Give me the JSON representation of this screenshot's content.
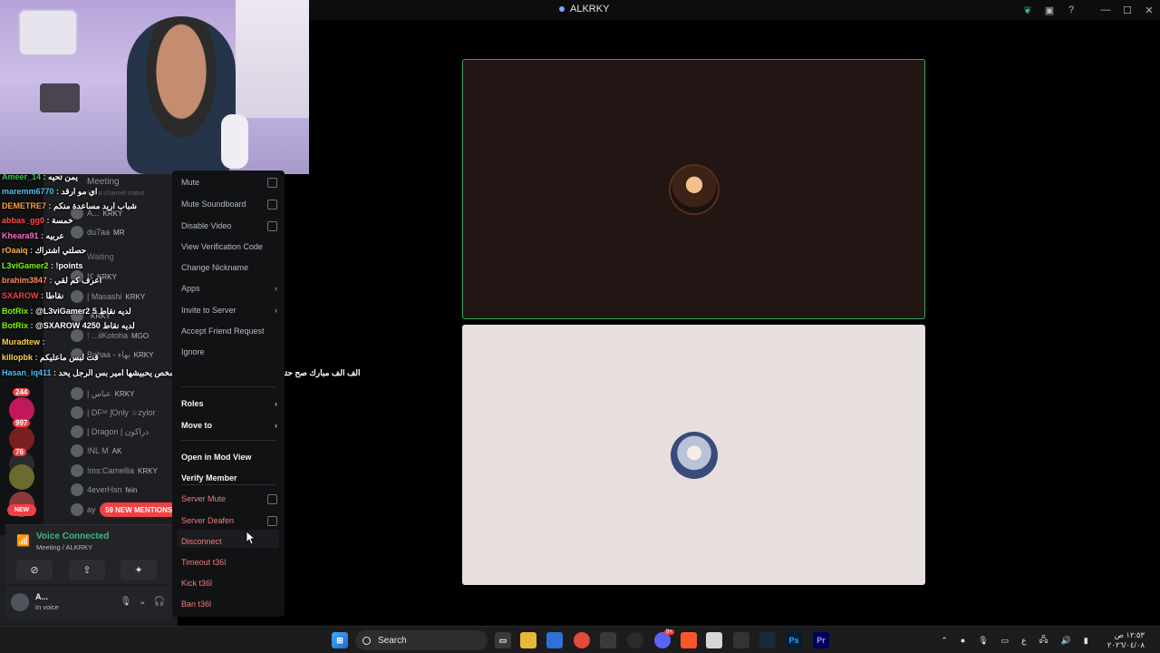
{
  "window": {
    "title": "ALKRKY"
  },
  "chat": [
    {
      "user": "Ameer_14",
      "msg": "يمن تحيه",
      "color": "#36c75b"
    },
    {
      "user": "maremm6770",
      "msg": "اي مو ارقد",
      "color": "#4fc3f7"
    },
    {
      "user": "DEMETRE7",
      "msg": "شباب اريد مساعدة منكم",
      "color": "#ff9e3d"
    },
    {
      "user": "abbas_gg0",
      "msg": "خمسة",
      "color": "#ff4f4f"
    },
    {
      "user": "Kheara91",
      "msg": "عربيه",
      "color": "#ff6bd0"
    },
    {
      "user": "rOaaiq",
      "msg": "حصلتي اشتراك",
      "color": "#ffb347"
    },
    {
      "user": "L3viGamer2",
      "msg": "!points",
      "color": "#7cfc00"
    },
    {
      "user": "brahim3847",
      "msg": "اعرف كم لقي",
      "color": "#ff8a65"
    },
    {
      "user": "SXAROW",
      "msg": "نقاطا",
      "color": "#ff4040"
    },
    {
      "user": "BotRix",
      "msg": "@L3viGamer2 لديه نقاط 5",
      "color": "#7cfc00"
    },
    {
      "user": "BotRix",
      "msg": "@SXAROW لديه نقاط 4250",
      "color": "#7cfc00"
    },
    {
      "user": "Muradtew",
      "msg": "",
      "color": "#ffd54f"
    },
    {
      "user": "killopbk",
      "msg": "قت لبس ماعليكم",
      "color": "#ffd54f"
    },
    {
      "user": "Hasan_iq411",
      "msg": "الف الف مبارك صح حته البنيه بس البتيه ممكن تتزوج كبشخص يحبيشها امير بس الرجل يحد",
      "color": "#4fc3f7"
    }
  ],
  "sidebar": {
    "channel": "Meeting",
    "channel_status": "Set a channel status",
    "members": [
      {
        "name": "A...",
        "tag": "KRKY"
      },
      {
        "name": "du7aa",
        "tag": "MR"
      },
      {
        "name": "Waiting",
        "tag": ""
      },
      {
        "name": "ﻛﺎ",
        "tag": "KRKY"
      },
      {
        "name": "| Masashi",
        "tag": "KRKY"
      },
      {
        "name": "",
        "tag": "KRKY"
      },
      {
        "name": "⁞ ...iiKotoha",
        "tag": "MGO"
      },
      {
        "name": "Bahaa - بهاء",
        "tag": "KRKY"
      },
      {
        "name": "| عباس",
        "tag": "KRKY"
      },
      {
        "name": "| DFˢˣ ʃOnly ☆zylor",
        "tag": ""
      },
      {
        "name": "| Dragon | دراكون",
        "tag": ""
      },
      {
        "name": "!NL M",
        "tag": "AK"
      },
      {
        "name": "!ms:Camellia",
        "tag": "KRKY"
      },
      {
        "name": "4everHsn",
        "tag": "fein"
      },
      {
        "name": "ay",
        "tag": ""
      }
    ],
    "guild_badges": [
      "244",
      "997",
      "76"
    ],
    "new_label": "NEW",
    "mentions": "59 NEW MENTIONS"
  },
  "voice": {
    "status": "Voice Connected",
    "location": "Meeting / ALKRKY"
  },
  "user": {
    "name": "A...",
    "status": "In voice"
  },
  "context_menu": {
    "items": [
      {
        "label": "Mute",
        "kind": "checkbox",
        "style": "normal"
      },
      {
        "label": "Mute Soundboard",
        "kind": "checkbox",
        "style": "normal"
      },
      {
        "label": "Disable Video",
        "kind": "checkbox",
        "style": "normal"
      },
      {
        "label": "View Verification Code",
        "kind": "item",
        "style": "normal"
      },
      {
        "label": "Change Nickname",
        "kind": "item",
        "style": "normal"
      },
      {
        "label": "Apps",
        "kind": "submenu",
        "style": "normal"
      },
      {
        "label": "Invite to Server",
        "kind": "submenu",
        "style": "normal"
      },
      {
        "label": "Accept Friend Request",
        "kind": "item",
        "style": "normal"
      },
      {
        "label": "Ignore",
        "kind": "item",
        "style": "normal"
      },
      {
        "label": "Roles",
        "kind": "submenu",
        "style": "bold"
      },
      {
        "label": "Move to",
        "kind": "submenu",
        "style": "bold"
      },
      {
        "label": "Open in Mod View",
        "kind": "item",
        "style": "bold"
      },
      {
        "label": "Verify Member",
        "kind": "item",
        "style": "bold"
      },
      {
        "label": "Server Mute",
        "kind": "checkbox",
        "style": "danger"
      },
      {
        "label": "Server Deafen",
        "kind": "checkbox",
        "style": "danger"
      },
      {
        "label": "Disconnect",
        "kind": "item",
        "style": "danger"
      },
      {
        "label": "Timeout t36l",
        "kind": "item",
        "style": "danger"
      },
      {
        "label": "Kick t36l",
        "kind": "item",
        "style": "danger"
      },
      {
        "label": "Ban t36l",
        "kind": "item",
        "style": "danger"
      }
    ]
  },
  "taskbar": {
    "search_label": "Search",
    "apps": [
      "file-explorer",
      "store",
      "chrome",
      "steam",
      "discord",
      "brave",
      "photoshop",
      "premiere"
    ],
    "discord_badge": "9+",
    "tray_lang": "ع",
    "time": "١٢:٥٣ ص",
    "date": "٢٠٢٦/٠٤/٠٨"
  },
  "colors": {
    "accent_green": "#3ba55d",
    "danger": "#f47b7b",
    "mentions_red": "#f23f43"
  }
}
